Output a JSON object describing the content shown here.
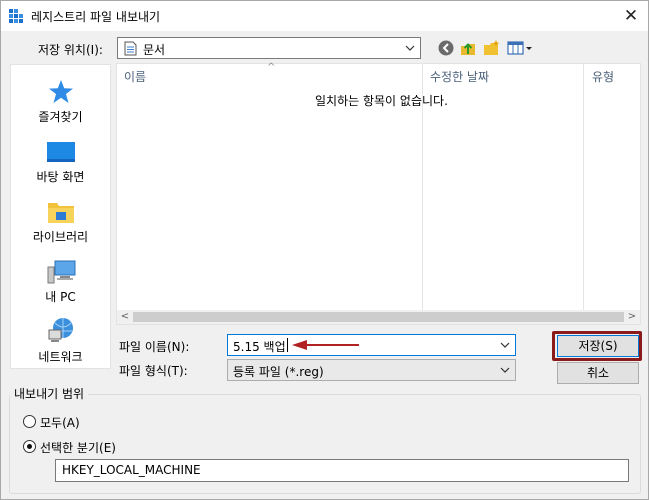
{
  "window": {
    "title": "레지스트리 파일 내보내기",
    "close_glyph": "✕"
  },
  "location": {
    "label": "저장 위치(I):",
    "value": "문서"
  },
  "places": [
    {
      "label": "즐겨찾기",
      "icon": "star-icon"
    },
    {
      "label": "바탕 화면",
      "icon": "desktop-icon"
    },
    {
      "label": "라이브러리",
      "icon": "folder-icon"
    },
    {
      "label": "내 PC",
      "icon": "computer-icon"
    },
    {
      "label": "네트워크",
      "icon": "network-icon"
    }
  ],
  "filelist": {
    "columns": [
      "이름",
      "수정한 날짜",
      "유형"
    ],
    "sort_caret": "^",
    "empty_message": "일치하는 항목이 없습니다.",
    "scroll_left": "<",
    "scroll_right": ">"
  },
  "filename": {
    "label": "파일 이름(N):",
    "value": "5.15 백업"
  },
  "filetype": {
    "label": "파일 형식(T):",
    "value": "등록 파일 (*.reg)"
  },
  "buttons": {
    "save": "저장(S)",
    "cancel": "취소"
  },
  "export_range": {
    "legend": "내보내기 범위",
    "options": [
      {
        "label": "모두(A)",
        "checked": false
      },
      {
        "label": "선택한 분기(E)",
        "checked": true
      }
    ],
    "branch_value": "HKEY_LOCAL_MACHINE"
  },
  "colors": {
    "accent": "#0078d7",
    "highlight_box": "#8b1a1a",
    "arrow": "#b22222"
  }
}
